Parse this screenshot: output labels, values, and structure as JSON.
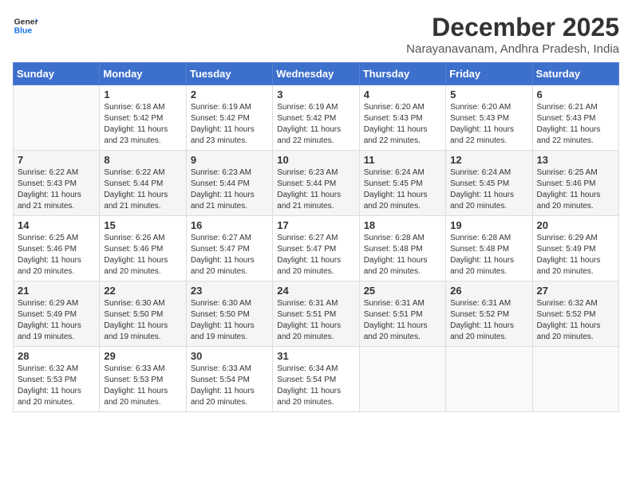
{
  "header": {
    "logo_line1": "General",
    "logo_line2": "Blue",
    "month": "December 2025",
    "location": "Narayanavanam, Andhra Pradesh, India"
  },
  "weekdays": [
    "Sunday",
    "Monday",
    "Tuesday",
    "Wednesday",
    "Thursday",
    "Friday",
    "Saturday"
  ],
  "weeks": [
    [
      {
        "day": "",
        "text": ""
      },
      {
        "day": "1",
        "text": "Sunrise: 6:18 AM\nSunset: 5:42 PM\nDaylight: 11 hours\nand 23 minutes."
      },
      {
        "day": "2",
        "text": "Sunrise: 6:19 AM\nSunset: 5:42 PM\nDaylight: 11 hours\nand 23 minutes."
      },
      {
        "day": "3",
        "text": "Sunrise: 6:19 AM\nSunset: 5:42 PM\nDaylight: 11 hours\nand 22 minutes."
      },
      {
        "day": "4",
        "text": "Sunrise: 6:20 AM\nSunset: 5:43 PM\nDaylight: 11 hours\nand 22 minutes."
      },
      {
        "day": "5",
        "text": "Sunrise: 6:20 AM\nSunset: 5:43 PM\nDaylight: 11 hours\nand 22 minutes."
      },
      {
        "day": "6",
        "text": "Sunrise: 6:21 AM\nSunset: 5:43 PM\nDaylight: 11 hours\nand 22 minutes."
      }
    ],
    [
      {
        "day": "7",
        "text": "Sunrise: 6:22 AM\nSunset: 5:43 PM\nDaylight: 11 hours\nand 21 minutes."
      },
      {
        "day": "8",
        "text": "Sunrise: 6:22 AM\nSunset: 5:44 PM\nDaylight: 11 hours\nand 21 minutes."
      },
      {
        "day": "9",
        "text": "Sunrise: 6:23 AM\nSunset: 5:44 PM\nDaylight: 11 hours\nand 21 minutes."
      },
      {
        "day": "10",
        "text": "Sunrise: 6:23 AM\nSunset: 5:44 PM\nDaylight: 11 hours\nand 21 minutes."
      },
      {
        "day": "11",
        "text": "Sunrise: 6:24 AM\nSunset: 5:45 PM\nDaylight: 11 hours\nand 20 minutes."
      },
      {
        "day": "12",
        "text": "Sunrise: 6:24 AM\nSunset: 5:45 PM\nDaylight: 11 hours\nand 20 minutes."
      },
      {
        "day": "13",
        "text": "Sunrise: 6:25 AM\nSunset: 5:46 PM\nDaylight: 11 hours\nand 20 minutes."
      }
    ],
    [
      {
        "day": "14",
        "text": "Sunrise: 6:25 AM\nSunset: 5:46 PM\nDaylight: 11 hours\nand 20 minutes."
      },
      {
        "day": "15",
        "text": "Sunrise: 6:26 AM\nSunset: 5:46 PM\nDaylight: 11 hours\nand 20 minutes."
      },
      {
        "day": "16",
        "text": "Sunrise: 6:27 AM\nSunset: 5:47 PM\nDaylight: 11 hours\nand 20 minutes."
      },
      {
        "day": "17",
        "text": "Sunrise: 6:27 AM\nSunset: 5:47 PM\nDaylight: 11 hours\nand 20 minutes."
      },
      {
        "day": "18",
        "text": "Sunrise: 6:28 AM\nSunset: 5:48 PM\nDaylight: 11 hours\nand 20 minutes."
      },
      {
        "day": "19",
        "text": "Sunrise: 6:28 AM\nSunset: 5:48 PM\nDaylight: 11 hours\nand 20 minutes."
      },
      {
        "day": "20",
        "text": "Sunrise: 6:29 AM\nSunset: 5:49 PM\nDaylight: 11 hours\nand 20 minutes."
      }
    ],
    [
      {
        "day": "21",
        "text": "Sunrise: 6:29 AM\nSunset: 5:49 PM\nDaylight: 11 hours\nand 19 minutes."
      },
      {
        "day": "22",
        "text": "Sunrise: 6:30 AM\nSunset: 5:50 PM\nDaylight: 11 hours\nand 19 minutes."
      },
      {
        "day": "23",
        "text": "Sunrise: 6:30 AM\nSunset: 5:50 PM\nDaylight: 11 hours\nand 19 minutes."
      },
      {
        "day": "24",
        "text": "Sunrise: 6:31 AM\nSunset: 5:51 PM\nDaylight: 11 hours\nand 20 minutes."
      },
      {
        "day": "25",
        "text": "Sunrise: 6:31 AM\nSunset: 5:51 PM\nDaylight: 11 hours\nand 20 minutes."
      },
      {
        "day": "26",
        "text": "Sunrise: 6:31 AM\nSunset: 5:52 PM\nDaylight: 11 hours\nand 20 minutes."
      },
      {
        "day": "27",
        "text": "Sunrise: 6:32 AM\nSunset: 5:52 PM\nDaylight: 11 hours\nand 20 minutes."
      }
    ],
    [
      {
        "day": "28",
        "text": "Sunrise: 6:32 AM\nSunset: 5:53 PM\nDaylight: 11 hours\nand 20 minutes."
      },
      {
        "day": "29",
        "text": "Sunrise: 6:33 AM\nSunset: 5:53 PM\nDaylight: 11 hours\nand 20 minutes."
      },
      {
        "day": "30",
        "text": "Sunrise: 6:33 AM\nSunset: 5:54 PM\nDaylight: 11 hours\nand 20 minutes."
      },
      {
        "day": "31",
        "text": "Sunrise: 6:34 AM\nSunset: 5:54 PM\nDaylight: 11 hours\nand 20 minutes."
      },
      {
        "day": "",
        "text": ""
      },
      {
        "day": "",
        "text": ""
      },
      {
        "day": "",
        "text": ""
      }
    ]
  ]
}
